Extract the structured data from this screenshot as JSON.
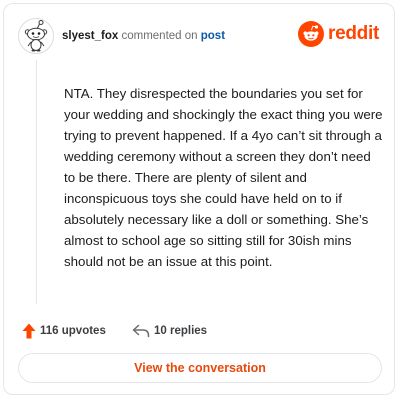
{
  "header": {
    "username": "slyest_fox",
    "action_text": "commented on",
    "post_link": "post",
    "brand": "reddit"
  },
  "comment": {
    "body": "NTA. They disrespected the boundaries you set for your wedding and shockingly the exact thing you were trying to prevent happened. If a 4yo can’t sit through a wedding ceremony without a screen they don’t need to be there. There are plenty of silent and inconspicuous toys she could have held on to if absolutely necessary like a doll or something. She’s almost to school age so sitting still for 30ish mins should not be an issue at this point."
  },
  "actions": {
    "upvotes": "116 upvotes",
    "replies": "10 replies"
  },
  "cta": {
    "label": "View the conversation"
  },
  "colors": {
    "brand": "#ff4500",
    "link": "#0a5aa8",
    "border": "#e4e7ea"
  },
  "icons": {
    "avatar": "snoo-avatar-icon",
    "logo": "reddit-snoo-icon",
    "upvote": "upvote-arrow-icon",
    "reply": "reply-arrow-icon"
  }
}
